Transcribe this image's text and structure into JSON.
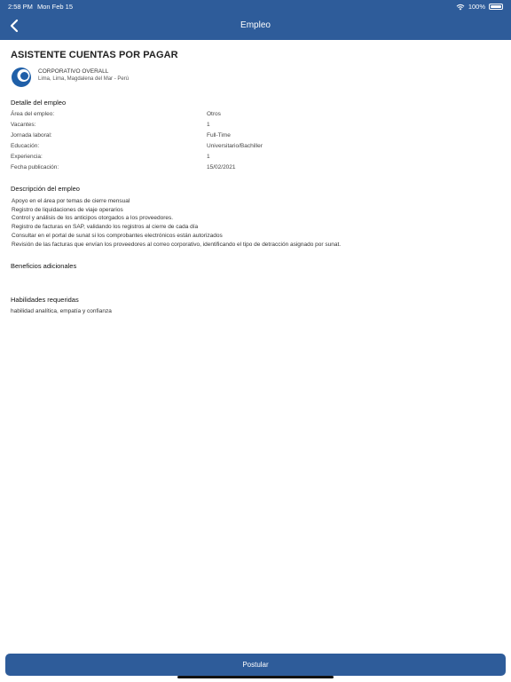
{
  "status_bar": {
    "time": "2:58 PM",
    "date": "Mon Feb 15",
    "battery": "100%"
  },
  "header": {
    "title": "Empleo"
  },
  "job": {
    "title": "ASISTENTE CUENTAS POR PAGAR",
    "company": "CORPORATIVO OVERALL",
    "location": "Lima, Lima, Magdalena del Mar - Perú"
  },
  "details": {
    "heading": "Detalle del empleo",
    "rows": [
      {
        "label": "Área del empleo:",
        "value": "Otros"
      },
      {
        "label": "Vacantes:",
        "value": "1"
      },
      {
        "label": "Jornada laboral:",
        "value": "Full-Time"
      },
      {
        "label": "Educación:",
        "value": "Universitario/Bachiller"
      },
      {
        "label": "Experiencia:",
        "value": "1"
      },
      {
        "label": "Fecha publicación:",
        "value": "15/02/2021"
      }
    ]
  },
  "description": {
    "heading": "Descripción del empleo",
    "lines": [
      "Apoyo en el área por temas de cierre mensual",
      "Registro de liquidaciones de viaje operarios",
      "Control y análisis de los anticipos otorgados a los proveedores.",
      "Registro de facturas en SAP, validando los registros al cierre de cada día",
      "Consultar en el portal de sunat si los comprobantes electrónicos están autorizados",
      "Revisión de las facturas que envían los proveedores al correo corporativo, identificando el tipo de detracción asignado por sunat."
    ]
  },
  "benefits": {
    "heading": "Beneficios adicionales"
  },
  "skills": {
    "heading": "Habilidades requeridas",
    "text": "habilidad analítica, empatía y confianza"
  },
  "apply_button": {
    "label": "Postular"
  }
}
